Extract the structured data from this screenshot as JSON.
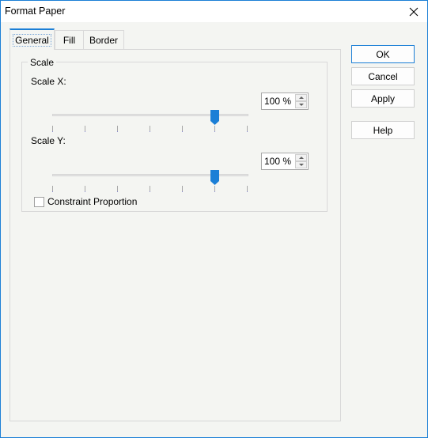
{
  "window": {
    "title": "Format Paper",
    "close_icon": "close-icon"
  },
  "tabs": [
    {
      "label": "General",
      "active": true
    },
    {
      "label": "Fill",
      "active": false
    },
    {
      "label": "Border",
      "active": false
    }
  ],
  "general": {
    "scale_group": {
      "legend": "Scale",
      "scale_x": {
        "label": "Scale X:",
        "value": "100 %",
        "slider": {
          "tick_count": 7,
          "selected_tick_index": 5
        }
      },
      "scale_y": {
        "label": "Scale Y:",
        "value": "100 %",
        "slider": {
          "tick_count": 7,
          "selected_tick_index": 5
        }
      },
      "constraint_proportion": {
        "label": "Constraint Proportion",
        "checked": false
      }
    }
  },
  "buttons": {
    "ok": "OK",
    "cancel": "Cancel",
    "apply": "Apply",
    "help": "Help"
  },
  "colors": {
    "accent": "#1b7fd6",
    "background": "#f4f5f2"
  }
}
